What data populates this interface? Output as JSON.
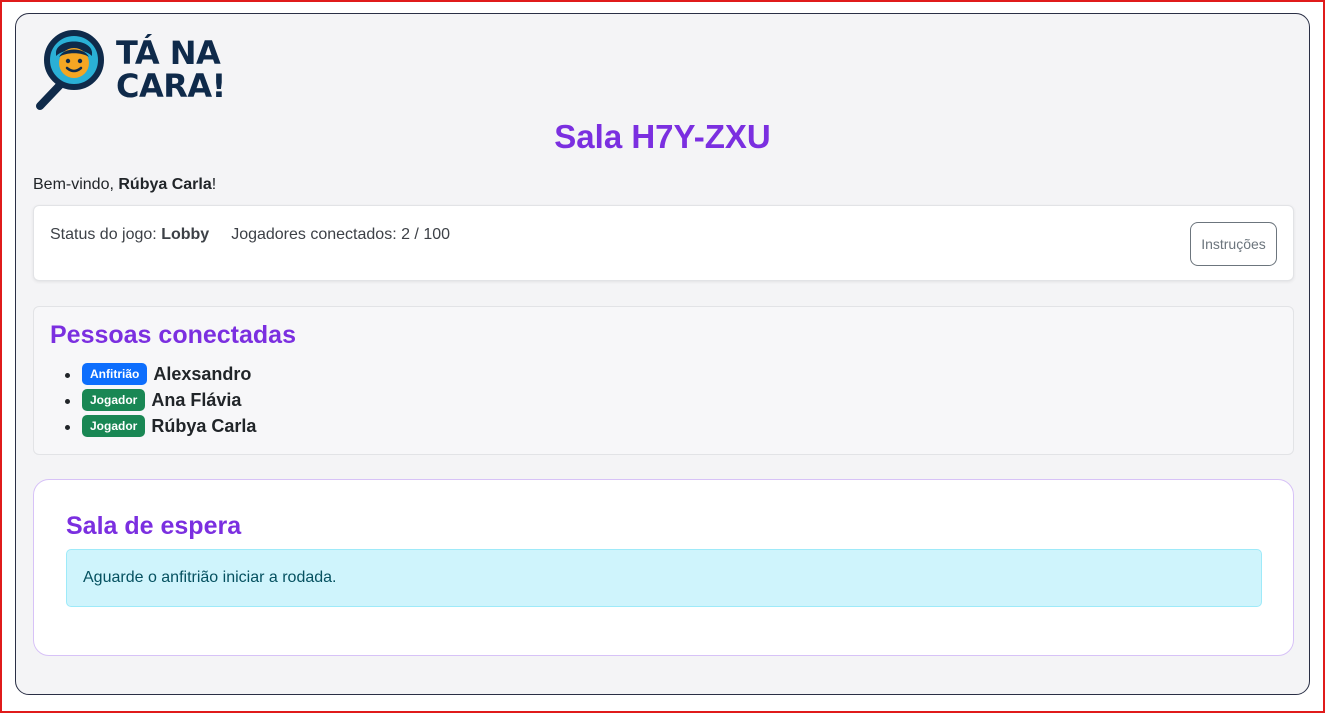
{
  "app": {
    "logo_text_line1": "TÁ NA",
    "logo_text_line2": "CARA!"
  },
  "room": {
    "title": "Sala H7Y-ZXU"
  },
  "welcome": {
    "prefix": "Bem-vindo, ",
    "user_name": "Rúbya Carla",
    "suffix": "!"
  },
  "status": {
    "label": "Status do jogo: ",
    "value": "Lobby",
    "players_label": "Jogadores conectados: 2 / 100",
    "instructions_button": "Instruções"
  },
  "people": {
    "title": "Pessoas conectadas",
    "items": [
      {
        "role": "Anfitrião",
        "name": "Alexsandro"
      },
      {
        "role": "Jogador",
        "name": "Ana Flávia"
      },
      {
        "role": "Jogador",
        "name": "Rúbya Carla"
      }
    ]
  },
  "waiting": {
    "title": "Sala de espera",
    "message": "Aguarde o anfitrião iniciar a rodada."
  },
  "colors": {
    "accent": "#7b2fe0",
    "host_badge": "#0d6efd",
    "player_badge": "#198754",
    "alert_bg": "#cff4fc",
    "logo_navy": "#0f2a4a",
    "logo_face": "#f5a623",
    "frame_border": "#e01b1b"
  },
  "icons": {
    "logo": "magnifier-face-icon"
  }
}
